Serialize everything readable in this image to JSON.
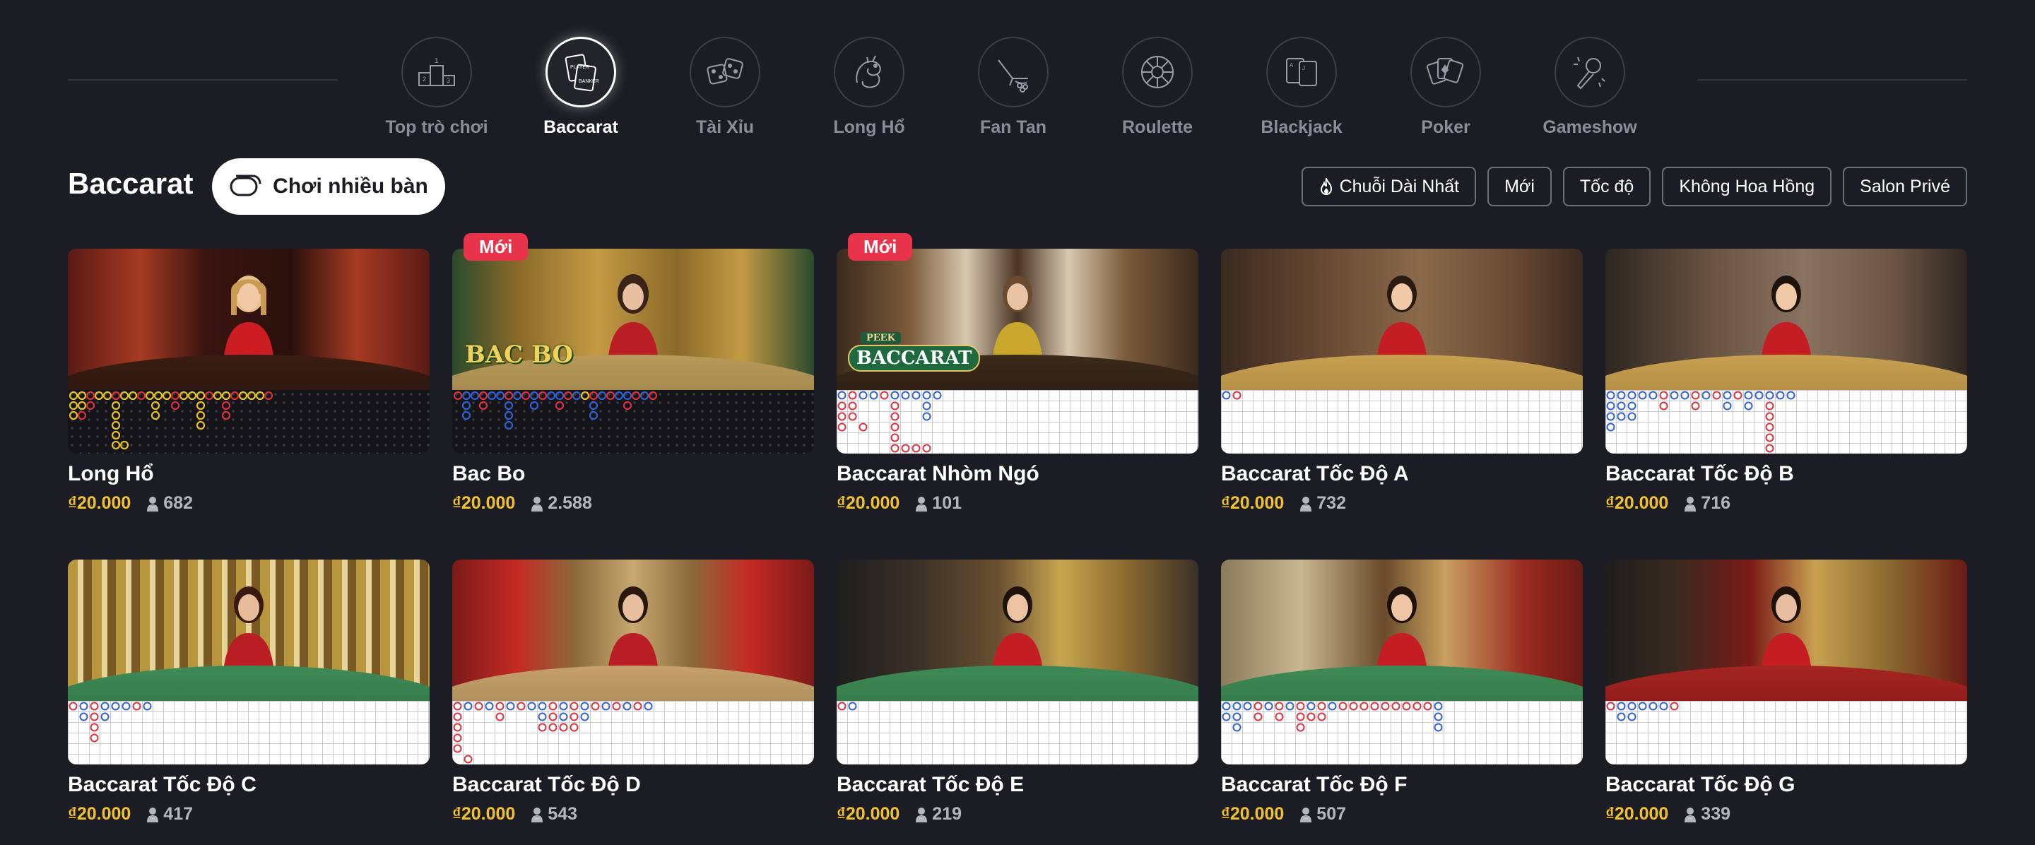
{
  "categories": [
    {
      "label": "Top trò chơi",
      "icon": "podium-icon",
      "active": false
    },
    {
      "label": "Baccarat",
      "icon": "baccarat-icon",
      "active": true
    },
    {
      "label": "Tài Xỉu",
      "icon": "dice-icon",
      "active": false
    },
    {
      "label": "Long Hổ",
      "icon": "dragon-icon",
      "active": false
    },
    {
      "label": "Fan Tan",
      "icon": "fan-tan-icon",
      "active": false
    },
    {
      "label": "Roulette",
      "icon": "roulette-icon",
      "active": false
    },
    {
      "label": "Blackjack",
      "icon": "cards-icon",
      "active": false
    },
    {
      "label": "Poker",
      "icon": "poker-icon",
      "active": false
    },
    {
      "label": "Gameshow",
      "icon": "microphone-icon",
      "active": false
    }
  ],
  "section": {
    "title": "Baccarat",
    "multi_table_label": "Chơi nhiều bàn"
  },
  "filters": [
    {
      "label": "Chuỗi Dài Nhất",
      "icon": "fire-icon"
    },
    {
      "label": "Mới"
    },
    {
      "label": "Tốc độ"
    },
    {
      "label": "Không Hoa Hồng"
    },
    {
      "label": "Salon Privé"
    }
  ],
  "badge_label": "Mới",
  "games": [
    {
      "title": "Long Hổ",
      "price": "₫20.000",
      "players": "682",
      "badge": false,
      "logo": ""
    },
    {
      "title": "Bac Bo",
      "price": "₫20.000",
      "players": "2.588",
      "badge": true,
      "logo": "BAC BO"
    },
    {
      "title": "Baccarat Nhòm Ngó",
      "price": "₫20.000",
      "players": "101",
      "badge": true,
      "logo": "BACCARAT",
      "logo_top": "PEEK"
    },
    {
      "title": "Baccarat Tốc Độ A",
      "price": "₫20.000",
      "players": "732",
      "badge": false,
      "logo": ""
    },
    {
      "title": "Baccarat Tốc Độ B",
      "price": "₫20.000",
      "players": "716",
      "badge": false,
      "logo": ""
    },
    {
      "title": "Baccarat Tốc Độ C",
      "price": "₫20.000",
      "players": "417",
      "badge": false,
      "logo": ""
    },
    {
      "title": "Baccarat Tốc Độ D",
      "price": "₫20.000",
      "players": "543",
      "badge": false,
      "logo": ""
    },
    {
      "title": "Baccarat Tốc Độ E",
      "price": "₫20.000",
      "players": "219",
      "badge": false,
      "logo": ""
    },
    {
      "title": "Baccarat Tốc Độ F",
      "price": "₫20.000",
      "players": "507",
      "badge": false,
      "logo": ""
    },
    {
      "title": "Baccarat Tốc Độ G",
      "price": "₫20.000",
      "players": "339",
      "badge": false,
      "logo": ""
    }
  ],
  "colors": {
    "background": "#1c1d24",
    "price": "#f2c12e",
    "badge": "#e8334a",
    "banker": "#d9313b",
    "player": "#2f5fd0",
    "dragon_tiger_yellow": "#e6c02a"
  }
}
